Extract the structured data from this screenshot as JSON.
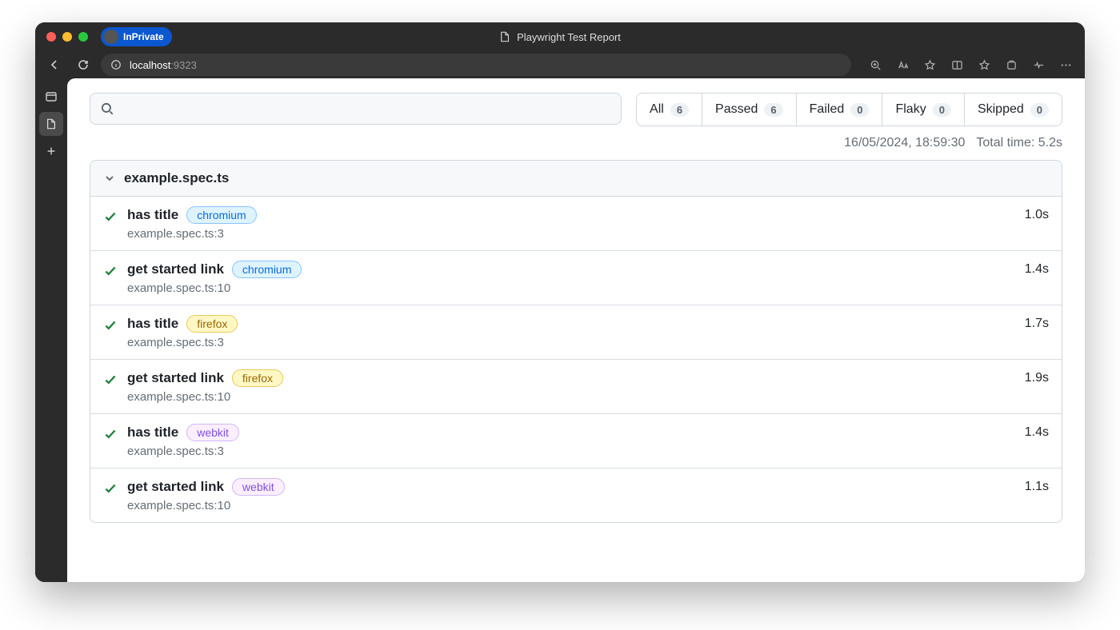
{
  "browser": {
    "inprivate_label": "InPrivate",
    "tab_title": "Playwright Test Report",
    "url_host": "localhost",
    "url_port": ":9323"
  },
  "filters": {
    "all": {
      "label": "All",
      "count": "6"
    },
    "passed": {
      "label": "Passed",
      "count": "6"
    },
    "failed": {
      "label": "Failed",
      "count": "0"
    },
    "flaky": {
      "label": "Flaky",
      "count": "0"
    },
    "skipped": {
      "label": "Skipped",
      "count": "0"
    }
  },
  "meta": {
    "timestamp": "16/05/2024, 18:59:30",
    "total_time": "Total time: 5.2s"
  },
  "file": {
    "name": "example.spec.ts",
    "tests": [
      {
        "title": "has title",
        "browser": "chromium",
        "path": "example.spec.ts:3",
        "duration": "1.0s"
      },
      {
        "title": "get started link",
        "browser": "chromium",
        "path": "example.spec.ts:10",
        "duration": "1.4s"
      },
      {
        "title": "has title",
        "browser": "firefox",
        "path": "example.spec.ts:3",
        "duration": "1.7s"
      },
      {
        "title": "get started link",
        "browser": "firefox",
        "path": "example.spec.ts:10",
        "duration": "1.9s"
      },
      {
        "title": "has title",
        "browser": "webkit",
        "path": "example.spec.ts:3",
        "duration": "1.4s"
      },
      {
        "title": "get started link",
        "browser": "webkit",
        "path": "example.spec.ts:10",
        "duration": "1.1s"
      }
    ]
  }
}
